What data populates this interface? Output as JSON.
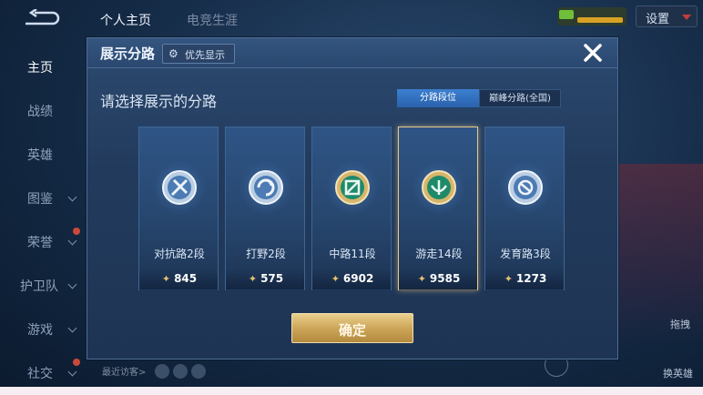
{
  "background": {
    "tabs": [
      "个人主页",
      "电竞生涯"
    ],
    "settings_label": "设置",
    "nav_items": [
      {
        "label": "主页",
        "active": true,
        "chevron": false,
        "dot": false
      },
      {
        "label": "战绩",
        "active": false,
        "chevron": false,
        "dot": false
      },
      {
        "label": "英雄",
        "active": false,
        "chevron": false,
        "dot": false
      },
      {
        "label": "图鉴",
        "active": false,
        "chevron": true,
        "dot": false
      },
      {
        "label": "荣誉",
        "active": false,
        "chevron": true,
        "dot": true
      },
      {
        "label": "护卫队",
        "active": false,
        "chevron": true,
        "dot": false
      },
      {
        "label": "游戏",
        "active": false,
        "chevron": true,
        "dot": false
      },
      {
        "label": "社交",
        "active": false,
        "chevron": true,
        "dot": true
      }
    ],
    "visitors_label": "最近访客>",
    "right_labels": [
      "拖拽",
      "换英雄"
    ]
  },
  "dialog": {
    "title": "展示分路",
    "pref_label": "优先显示",
    "subtitle": "请选择展示的分路",
    "segments": [
      "分路段位",
      "巅峰分路(全国)"
    ],
    "confirm_label": "确定",
    "cards": [
      {
        "rank": "对抗路2段",
        "score": "845",
        "icon": "clash-lane-emblem-icon",
        "selected": false
      },
      {
        "rank": "打野2段",
        "score": "575",
        "icon": "jungle-emblem-icon",
        "selected": false
      },
      {
        "rank": "中路11段",
        "score": "6902",
        "icon": "mid-lane-emblem-icon",
        "selected": false
      },
      {
        "rank": "游走14段",
        "score": "9585",
        "icon": "roam-emblem-icon",
        "selected": true
      },
      {
        "rank": "发育路3段",
        "score": "1273",
        "icon": "farm-lane-emblem-icon",
        "selected": false
      }
    ]
  },
  "colors": {
    "accent_gold": "#e9cf8e",
    "selected_border": "#e9c98a",
    "segment_active": "#3b7fd0"
  }
}
